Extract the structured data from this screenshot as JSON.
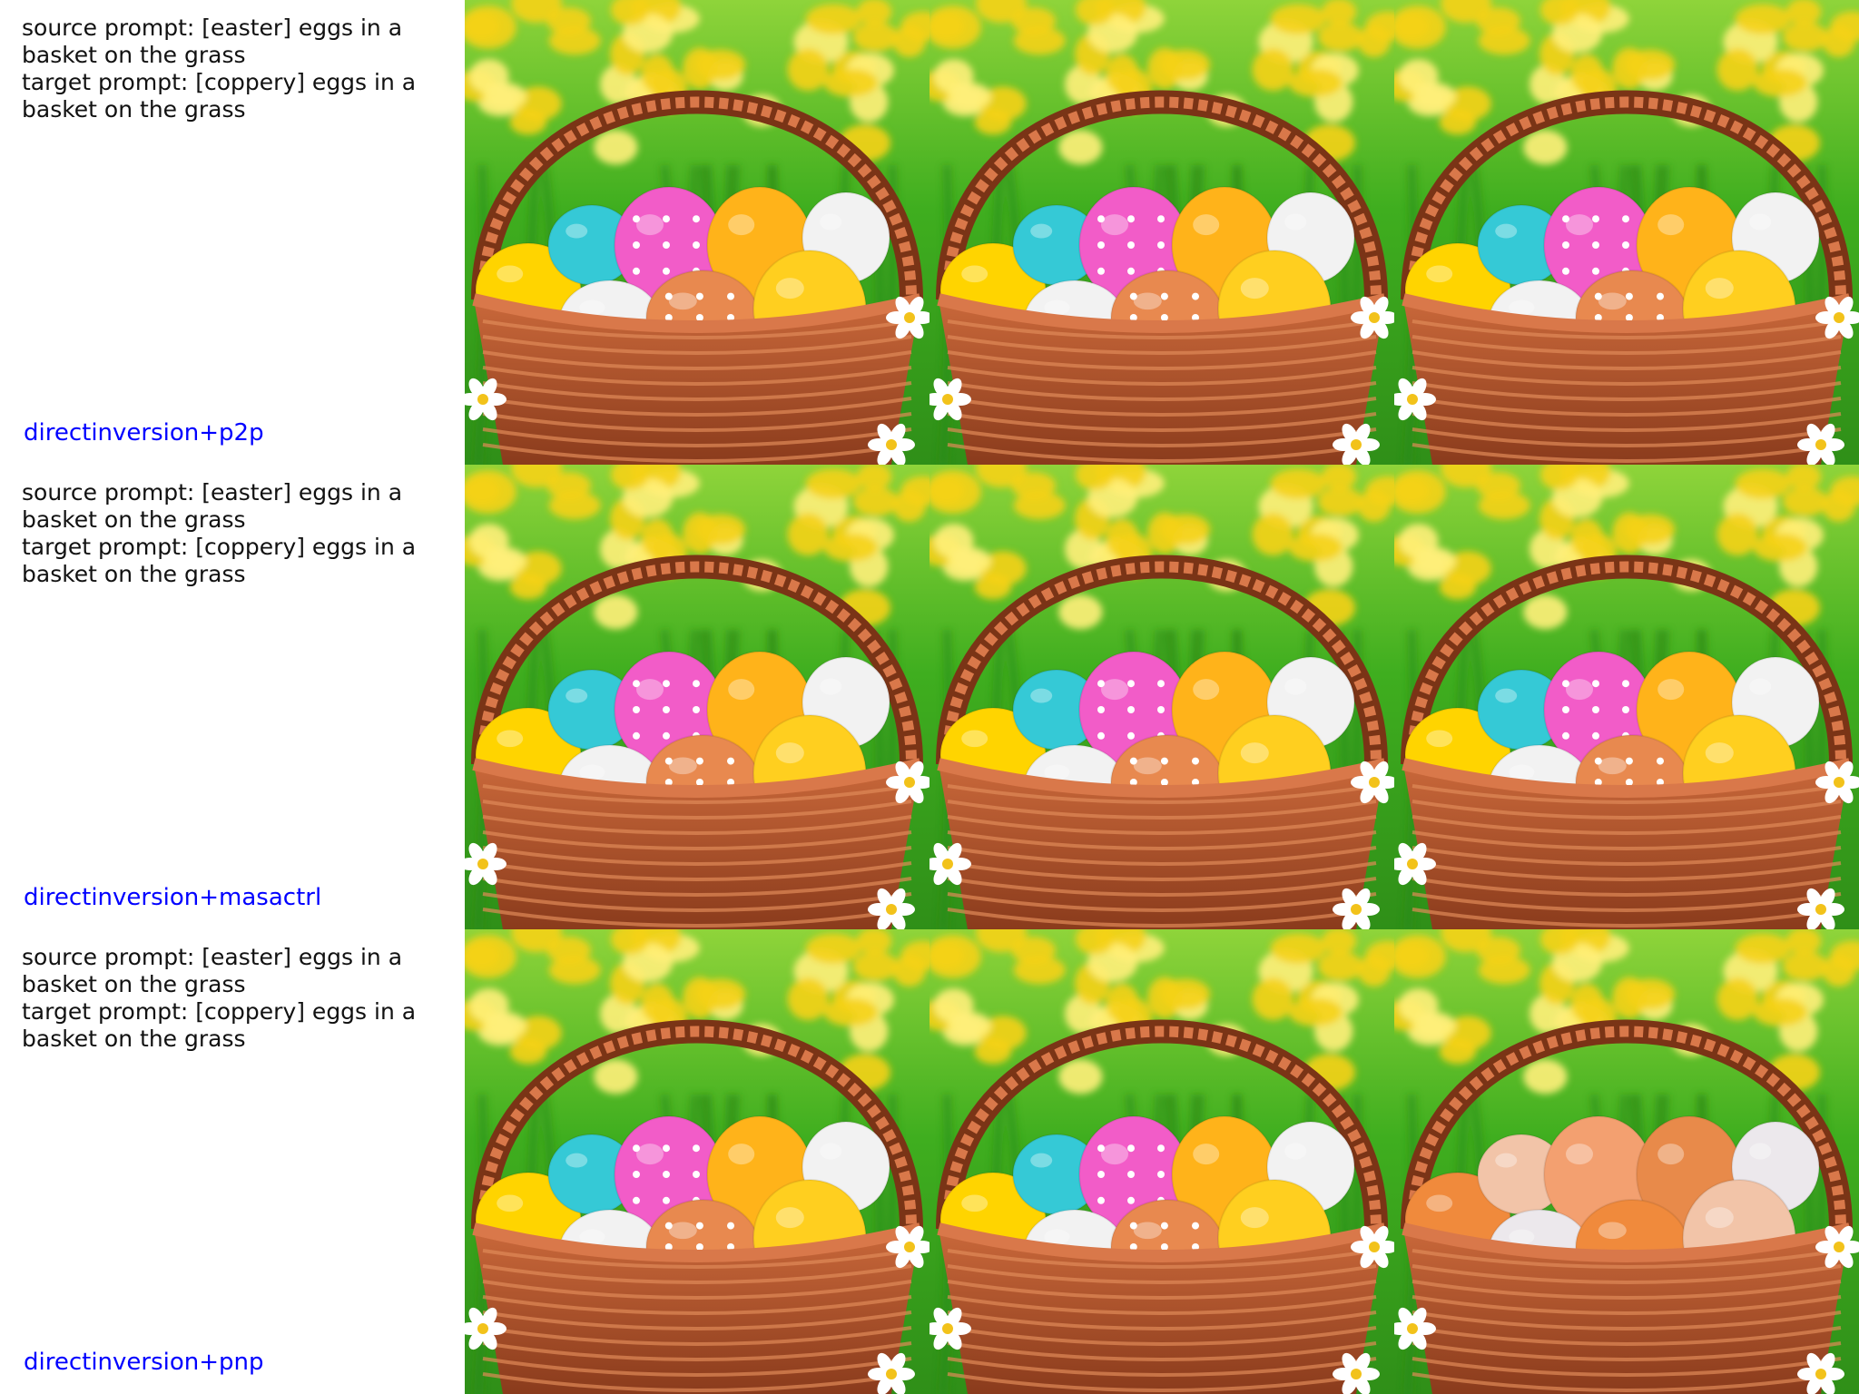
{
  "rows": [
    {
      "source_prompt": "source prompt: [easter] eggs in a basket on the grass",
      "target_prompt": "target prompt: [coppery] eggs in a basket on the grass",
      "method": "directinversion+p2p",
      "images": [
        "easter-eggs-basket",
        "easter-eggs-basket",
        "easter-eggs-basket-edited"
      ]
    },
    {
      "source_prompt": "source prompt: [easter] eggs in a basket on the grass",
      "target_prompt": "target prompt: [coppery] eggs in a basket on the grass",
      "method": "directinversion+masactrl",
      "images": [
        "easter-eggs-basket",
        "easter-eggs-basket",
        "easter-eggs-basket-edited"
      ]
    },
    {
      "source_prompt": "source prompt: [easter] eggs in a basket on the grass",
      "target_prompt": "target prompt: [coppery] eggs in a basket on the grass",
      "method": "directinversion+pnp",
      "images": [
        "easter-eggs-basket",
        "easter-eggs-basket",
        "coppery-eggs-basket"
      ]
    }
  ],
  "colors": {
    "method_label": "#0000ff",
    "prompt_text": "#111111",
    "grass": "#3fae1f",
    "flowers": "#f5d21a",
    "basket": "#b5562c",
    "egg_palette": [
      "#ffd400",
      "#35c9d6",
      "#f25cc8",
      "#ffb31a",
      "#f2f2f2",
      "#e8894f",
      "#ffcf1f"
    ],
    "copper_palette": [
      "#f08a3c",
      "#f2c4a8",
      "#f3a070",
      "#e88a4a",
      "#ece8ec"
    ]
  }
}
